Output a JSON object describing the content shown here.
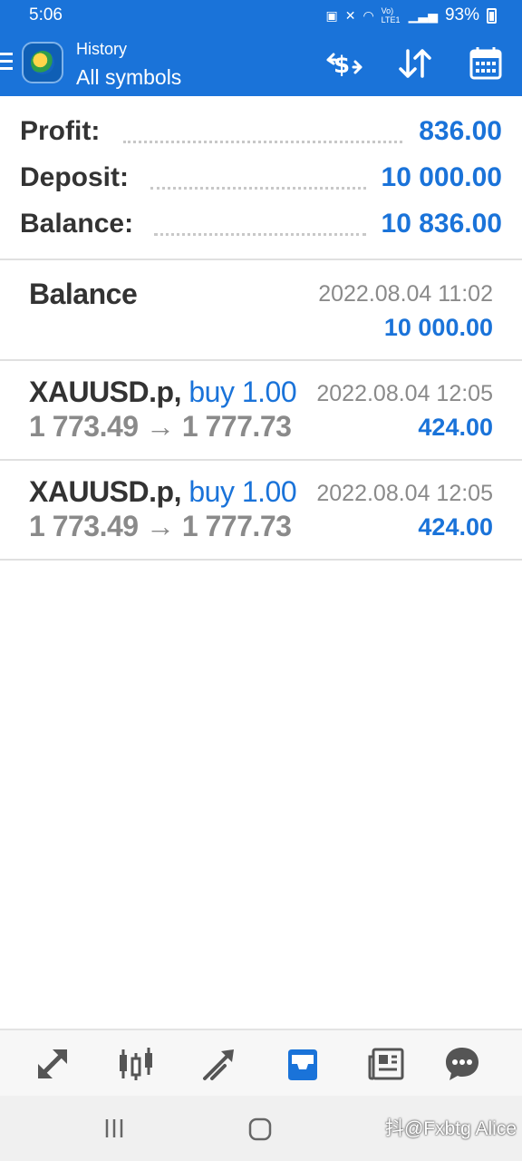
{
  "status_bar": {
    "time": "5:06",
    "battery_text": "93%",
    "network_text": "Vo) LTE1"
  },
  "toolbar": {
    "subtitle": "History",
    "title": "All symbols",
    "icons": [
      "menu-icon",
      "app-logo",
      "currency-exchange-icon",
      "sort-icon",
      "calendar-icon"
    ]
  },
  "summary": {
    "profit_label": "Profit:",
    "profit_value": "836.00",
    "deposit_label": "Deposit:",
    "deposit_value": "10 000.00",
    "balance_label": "Balance:",
    "balance_value": "10 836.00"
  },
  "entries": [
    {
      "title": "Balance",
      "date": "2022.08.04 11:02",
      "amount": "10 000.00"
    },
    {
      "symbol": "XAUUSD.p,",
      "direction": "buy 1.00",
      "prices": "1 773.49 → 1 777.73",
      "date": "2022.08.04 12:05",
      "amount": "424.00"
    },
    {
      "symbol": "XAUUSD.p,",
      "direction": "buy 1.00",
      "prices": "1 773.49 → 1 777.73",
      "date": "2022.08.04 12:05",
      "amount": "424.00"
    }
  ],
  "bottom_nav": {
    "items": [
      "quotes-icon",
      "chart-icon",
      "trade-icon",
      "history-icon",
      "news-icon",
      "chat-icon"
    ],
    "active": "history-icon"
  },
  "watermark": "抖@Fxbtg Alice",
  "colors": {
    "primary": "#1a73d9",
    "text_dark": "#333333",
    "text_gray": "#8a8a8a"
  }
}
